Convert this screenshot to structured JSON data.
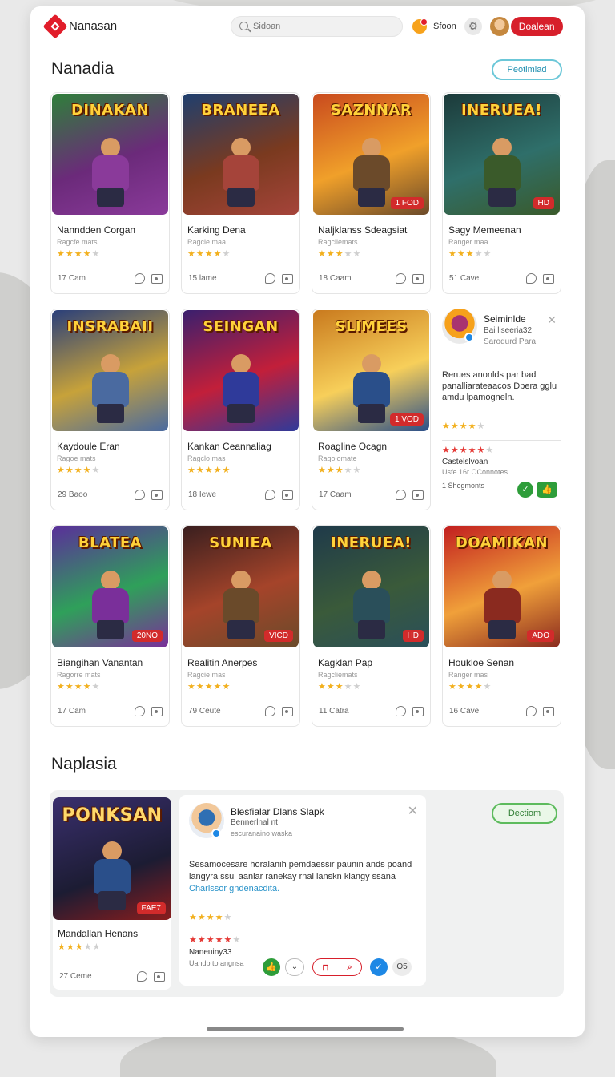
{
  "header": {
    "brand": "Nanasan",
    "search_placeholder": "Sidoan",
    "notif_label": "Sfoon",
    "action_button": "Doalean"
  },
  "sections": {
    "first_title": "Nanadia",
    "first_button": "Peotimlad",
    "second_title": "Naplasia",
    "second_button": "Dectiom"
  },
  "colors": {
    "accent": "#d71f2b",
    "green": "#2e9d3a",
    "star": "#f2b01e"
  },
  "cards": [
    {
      "art": "DINAKAN",
      "name": "Nanndden Corgan",
      "sub": "Ragcfe mats",
      "rating": 4,
      "count": "17 Cam",
      "tag": ""
    },
    {
      "art": "BRANEEA",
      "name": "Karking Dena",
      "sub": "Ragcle maa",
      "rating": 4.5,
      "count": "15 lame",
      "tag": ""
    },
    {
      "art": "SAZNNAR",
      "name": "Naljklanss Sdeagsiat",
      "sub": "Ragcliemats",
      "rating": 3,
      "count": "18 Caam",
      "tag": "1 FOD"
    },
    {
      "art": "INERUEA!",
      "name": "Sagy Memeenan",
      "sub": "Ranger maa",
      "rating": 3.5,
      "count": "51 Cave",
      "tag": "HD"
    },
    {
      "art": "INSRABAII",
      "name": "Kaydoule Eran",
      "sub": "Ragoe mats",
      "rating": 4,
      "count": "29 Baoo",
      "tag": ""
    },
    {
      "art": "SEINGAN",
      "name": "Kankan Ceannaliag",
      "sub": "Ragclo mas",
      "rating": 5,
      "count": "18 Iewe",
      "tag": ""
    },
    {
      "art": "SLIMEES",
      "name": "Roagline Ocagn",
      "sub": "Ragolomate",
      "rating": 3,
      "count": "17 Caam",
      "tag": "1 VOD"
    },
    {
      "art": "BLATEA",
      "name": "Biangihan Vanantan",
      "sub": "Ragorre mats",
      "rating": 4.5,
      "count": "17 Cam",
      "tag": "20NO"
    },
    {
      "art": "SUNIEA",
      "name": "Realitin Anerpes",
      "sub": "Ragcie mas",
      "rating": 5,
      "count": "79 Ceute",
      "tag": "VICD"
    },
    {
      "art": "INERUEA!",
      "name": "Kagklan Pap",
      "sub": "Ragcliemats",
      "rating": 3,
      "count": "11 Catra",
      "tag": "HD"
    },
    {
      "art": "DOAMIKAN",
      "name": "Houkloe Senan",
      "sub": "Ranger mas",
      "rating": 4.5,
      "count": "16 Cave",
      "tag": "ADO"
    }
  ],
  "side_review": {
    "name": "Seiminlde",
    "meta1": "Bai liseeria32",
    "meta2": "Sarodurd Para",
    "body": "Rerues anonlds par bad panalliarateaacos Dpera gglu amdu lpamogneln.",
    "user": "Castelslvoan",
    "user_meta": "Usfe 16r OConnotes",
    "foot": "1 Shegmonts"
  },
  "featured": {
    "art": "PONKSAN",
    "name": "Mandallan Henans",
    "rating": 3.5,
    "count": "27 Ceme",
    "tag": "FAE7"
  },
  "review": {
    "name": "Blesfialar Dlans Slapk",
    "meta1": "Bennerlnal nt",
    "meta2": "escuranaino waska",
    "body": "Sesamocesare horalanih pemdaessir paunin ands poand langyra ssul aanlar ranekay rnal lanskn klangy ssana",
    "link": "Charlssor gndenacdita.",
    "user": "Naneuiny33",
    "user_meta": "Uandb to angnsa",
    "count_btn": "O5"
  }
}
